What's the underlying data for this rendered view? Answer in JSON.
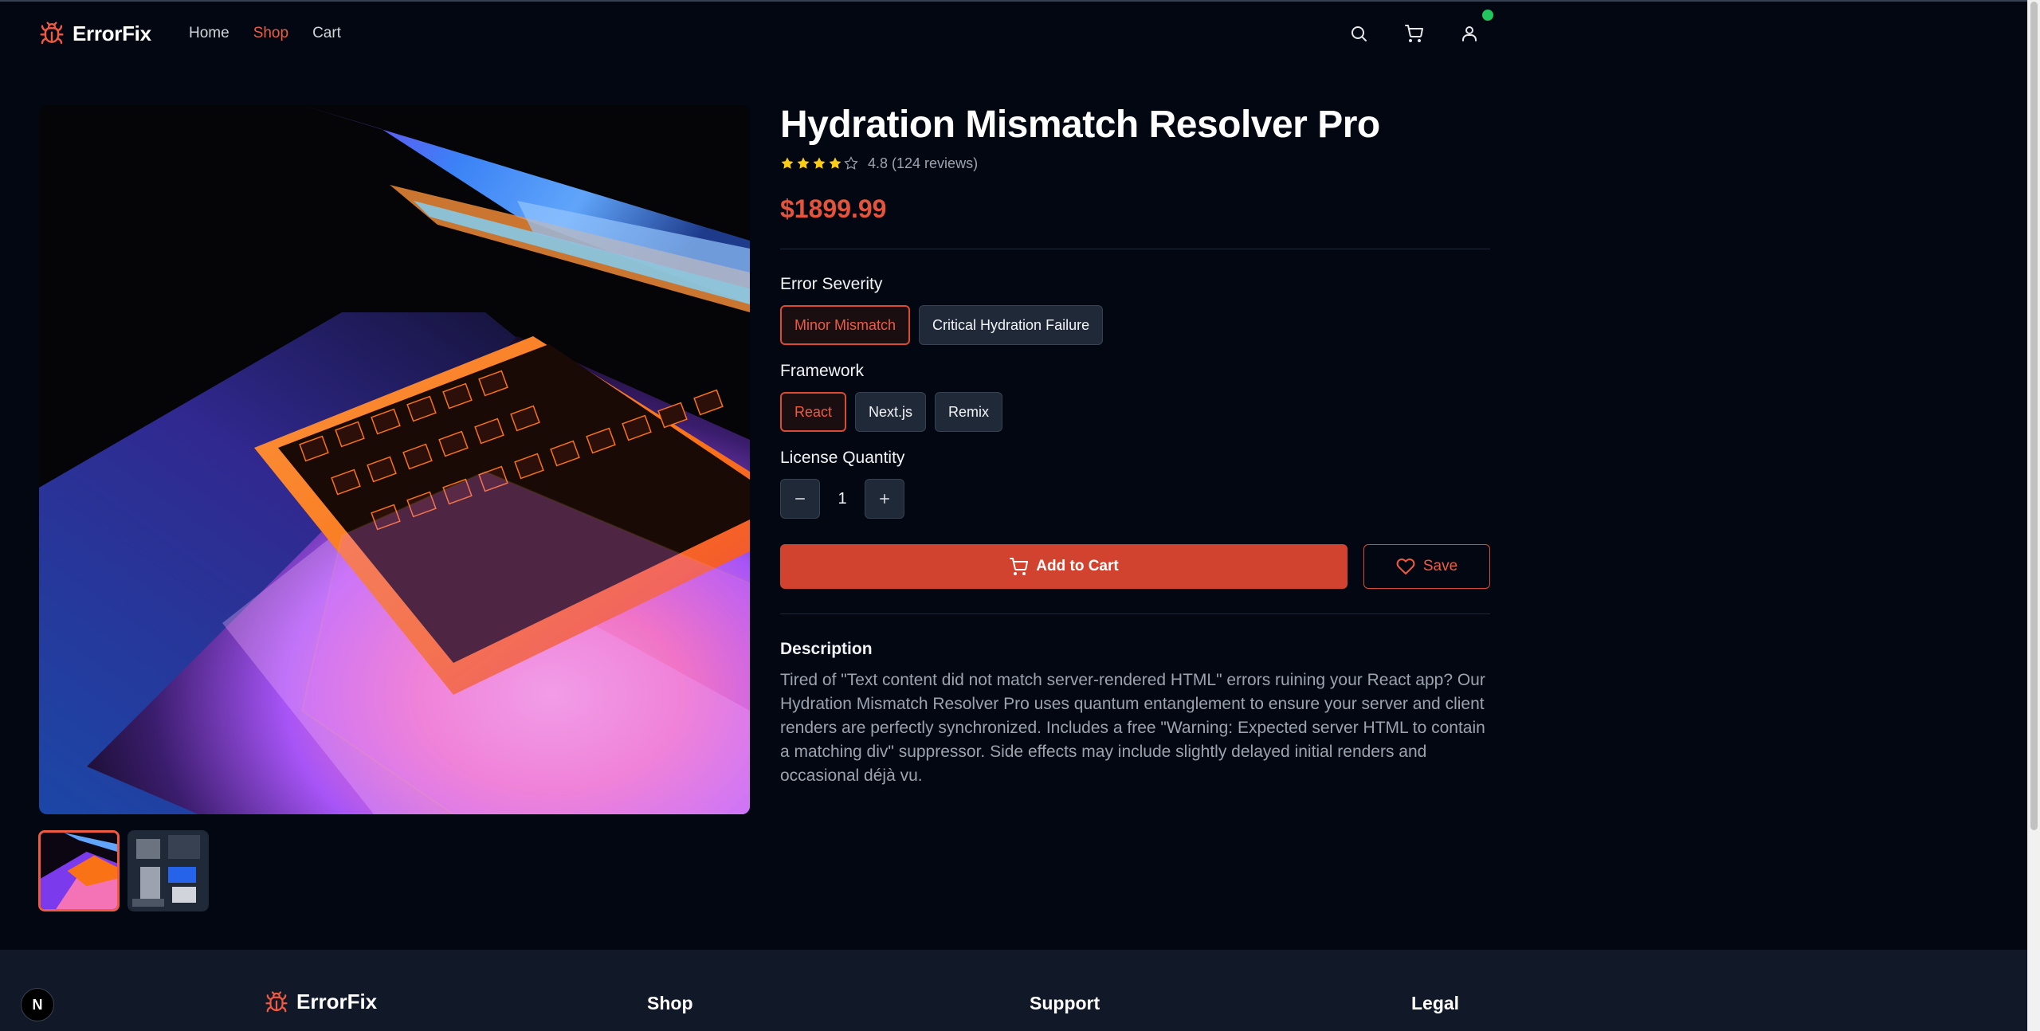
{
  "brand": {
    "name": "ErrorFix",
    "accent": "#ef5a43",
    "logo_icon": "bug-icon"
  },
  "nav": {
    "items": [
      {
        "label": "Home"
      },
      {
        "label": "Shop",
        "active": true
      },
      {
        "label": "Cart"
      }
    ]
  },
  "header_icons": [
    "search-icon",
    "cart-icon",
    "user-icon"
  ],
  "product": {
    "title": "Hydration Mismatch Resolver Pro",
    "rating": 4.8,
    "rating_text": "4.8 (124 reviews)",
    "stars_filled": 4,
    "price": "$1899.99",
    "options": {
      "severity": {
        "label": "Error Severity",
        "choices": [
          "Minor Mismatch",
          "Critical Hydration Failure"
        ],
        "selected": "Minor Mismatch"
      },
      "framework": {
        "label": "Framework",
        "choices": [
          "React",
          "Next.js",
          "Remix"
        ],
        "selected": "React"
      }
    },
    "quantity": {
      "label": "License Quantity",
      "value": "1"
    },
    "add_to_cart_label": "Add to Cart",
    "save_label": "Save",
    "description_title": "Description",
    "description": "Tired of \"Text content did not match server-rendered HTML\" errors ruining your React app? Our Hydration Mismatch Resolver Pro uses quantum entanglement to ensure your server and client renders are perfectly synchronized. Includes a free \"Warning: Expected server HTML to contain a matching div\" suppressor. Side effects may include slightly delayed initial renders and occasional déjà vu."
  },
  "footer": {
    "brand": "ErrorFix",
    "columns": [
      {
        "title": "Shop"
      },
      {
        "title": "Support"
      },
      {
        "title": "Legal"
      }
    ]
  },
  "dev_badge": "N"
}
